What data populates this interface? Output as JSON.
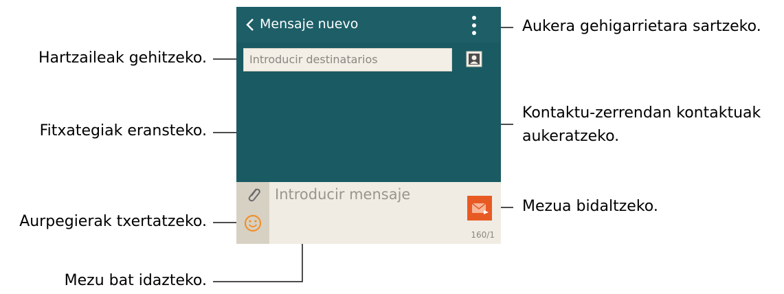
{
  "screen": {
    "title": "Mensaje nuevo",
    "recipient_placeholder": "Introducir destinatarios",
    "message_placeholder": "Introducir mensaje",
    "char_counter": "160/1"
  },
  "callouts": {
    "more_options": "Aukera gehigarrietara sartzeko.",
    "add_recipients": "Hartzaileak gehitzeko.",
    "contacts_line1": "Kontaktu-zerrendan kontaktuak",
    "contacts_line2": "aukeratzeko.",
    "attach_files": "Fitxategiak eransteko.",
    "insert_emoticons": "Aurpegierak txertatzeko.",
    "send_message": "Mezua bidaltzeko.",
    "write_message": "Mezu bat idazteko."
  },
  "colors": {
    "header_teal": "#1d5e67",
    "body_teal": "#1a5a63",
    "compose_bg": "#f0ece3",
    "send_orange": "#e85a24",
    "emoji_orange": "#f0902a"
  },
  "icons": [
    "chevron-left-icon",
    "more-vert-icon",
    "contacts-icon",
    "paperclip-icon",
    "smiley-icon",
    "envelope-send-icon"
  ]
}
